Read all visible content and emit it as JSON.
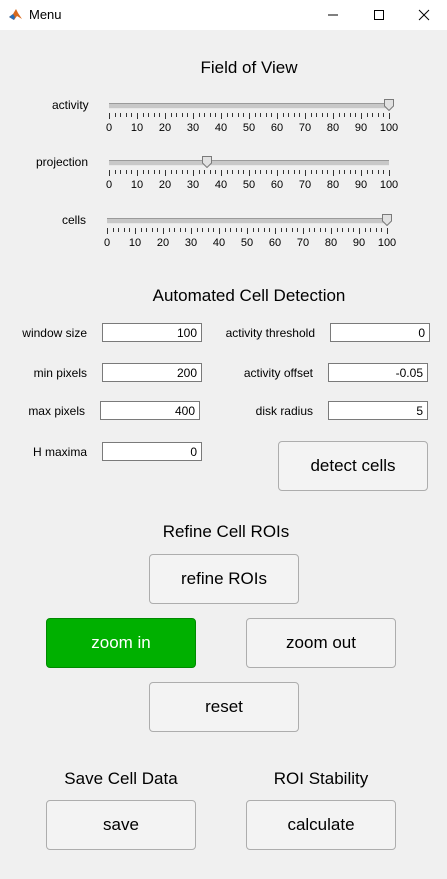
{
  "window": {
    "title": "Menu",
    "minimize_icon": "minimize-icon",
    "maximize_icon": "maximize-icon",
    "close_icon": "close-icon"
  },
  "field_of_view": {
    "title": "Field of View",
    "sliders": [
      {
        "label": "activity",
        "value": 100
      },
      {
        "label": "projection",
        "value": 35
      },
      {
        "label": "cells",
        "value": 100
      }
    ],
    "tick_labels": [
      "0",
      "10",
      "20",
      "30",
      "40",
      "50",
      "60",
      "70",
      "80",
      "90",
      "100"
    ]
  },
  "detection": {
    "title": "Automated Cell Detection",
    "window_size": {
      "label": "window size",
      "value": "100"
    },
    "min_pixels": {
      "label": "min pixels",
      "value": "200"
    },
    "max_pixels": {
      "label": "max pixels",
      "value": "400"
    },
    "h_maxima": {
      "label": "H maxima",
      "value": "0"
    },
    "activity_threshold": {
      "label": "activity threshold",
      "value": "0"
    },
    "activity_offset": {
      "label": "activity offset",
      "value": "-0.05"
    },
    "disk_radius": {
      "label": "disk radius",
      "value": "5"
    },
    "detect_button": "detect cells"
  },
  "refine": {
    "title": "Refine Cell ROIs",
    "refine_button": "refine ROIs",
    "zoom_in_button": "zoom in",
    "zoom_out_button": "zoom out",
    "reset_button": "reset",
    "accent": "#00b000"
  },
  "save": {
    "title": "Save Cell Data",
    "button": "save"
  },
  "stability": {
    "title": "ROI Stability",
    "button": "calculate"
  }
}
